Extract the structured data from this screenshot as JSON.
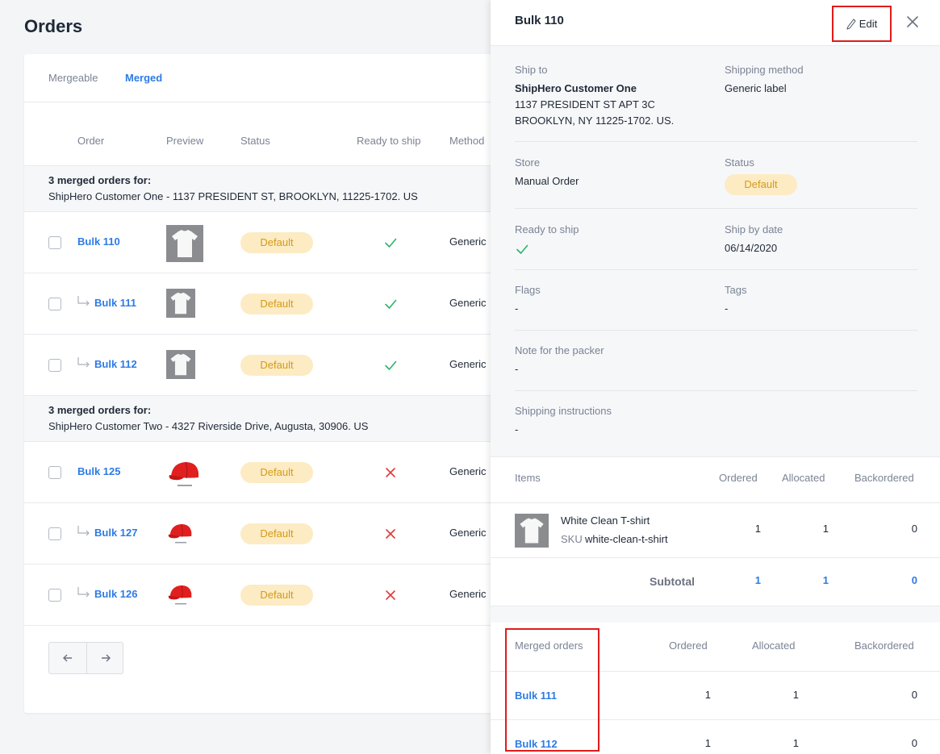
{
  "page": {
    "title": "Orders"
  },
  "tabs": [
    {
      "label": "Mergeable",
      "active": false
    },
    {
      "label": "Merged",
      "active": true
    }
  ],
  "table": {
    "columns": [
      "Order",
      "Preview",
      "Status",
      "Ready to ship",
      "Method"
    ],
    "groups": [
      {
        "title": "3 merged orders for:",
        "subtitle": "ShipHero Customer One - 1137 PRESIDENT ST, BROOKLYN, 11225-1702. US",
        "rows": [
          {
            "order": "Bulk 110",
            "child": false,
            "preview": "tshirt-image",
            "status": "Default",
            "ready": true,
            "method": "Generic"
          },
          {
            "order": "Bulk 111",
            "child": true,
            "preview": "tshirt-image",
            "status": "Default",
            "ready": true,
            "method": "Generic"
          },
          {
            "order": "Bulk 112",
            "child": true,
            "preview": "tshirt-image",
            "status": "Default",
            "ready": true,
            "method": "Generic"
          }
        ]
      },
      {
        "title": "3 merged orders for:",
        "subtitle": "ShipHero Customer Two - 4327 Riverside Drive, Augusta, 30906. US",
        "rows": [
          {
            "order": "Bulk 125",
            "child": false,
            "preview": "red-cap-image",
            "status": "Default",
            "ready": false,
            "method": "Generic"
          },
          {
            "order": "Bulk 127",
            "child": true,
            "preview": "red-cap-image",
            "status": "Default",
            "ready": false,
            "method": "Generic"
          },
          {
            "order": "Bulk 126",
            "child": true,
            "preview": "red-cap-image",
            "status": "Default",
            "ready": false,
            "method": "Generic"
          }
        ]
      }
    ]
  },
  "pager": {
    "prev_icon": "arrow-left-icon",
    "next_icon": "arrow-right-icon"
  },
  "drawer": {
    "title": "Bulk 110",
    "edit_label": "Edit",
    "details": {
      "ship_to_label": "Ship to",
      "ship_to_name": "ShipHero Customer One",
      "ship_to_line1": "1137 PRESIDENT ST APT 3C",
      "ship_to_line2": "BROOKLYN, NY 11225-1702. US.",
      "shipping_method_label": "Shipping method",
      "shipping_method": "Generic label",
      "store_label": "Store",
      "store": "Manual Order",
      "status_label": "Status",
      "status": "Default",
      "ready_label": "Ready to ship",
      "ready": true,
      "ship_by_label": "Ship by date",
      "ship_by": "06/14/2020",
      "flags_label": "Flags",
      "flags": "-",
      "tags_label": "Tags",
      "tags": "-",
      "note_label": "Note for the packer",
      "note": "-",
      "instructions_label": "Shipping instructions",
      "instructions": "-"
    },
    "items": {
      "columns": [
        "Items",
        "Ordered",
        "Allocated",
        "Backordered"
      ],
      "rows": [
        {
          "name": "White Clean T-shirt",
          "sku_label": "SKU",
          "sku": "white-clean-t-shirt",
          "ordered": "1",
          "allocated": "1",
          "backordered": "0"
        }
      ],
      "subtotal": {
        "label": "Subtotal",
        "ordered": "1",
        "allocated": "1",
        "backordered": "0"
      }
    },
    "merged": {
      "columns": [
        "Merged orders",
        "Ordered",
        "Allocated",
        "Backordered"
      ],
      "rows": [
        {
          "order": "Bulk 111",
          "ordered": "1",
          "allocated": "1",
          "backordered": "0"
        },
        {
          "order": "Bulk 112",
          "ordered": "1",
          "allocated": "1",
          "backordered": "0"
        }
      ]
    }
  },
  "colors": {
    "accent": "#2d7be5",
    "badge_bg": "#fdebc4",
    "badge_text": "#d49a16",
    "check": "#2db36b",
    "cross": "#e03a3a",
    "highlight": "#e01b1b"
  }
}
